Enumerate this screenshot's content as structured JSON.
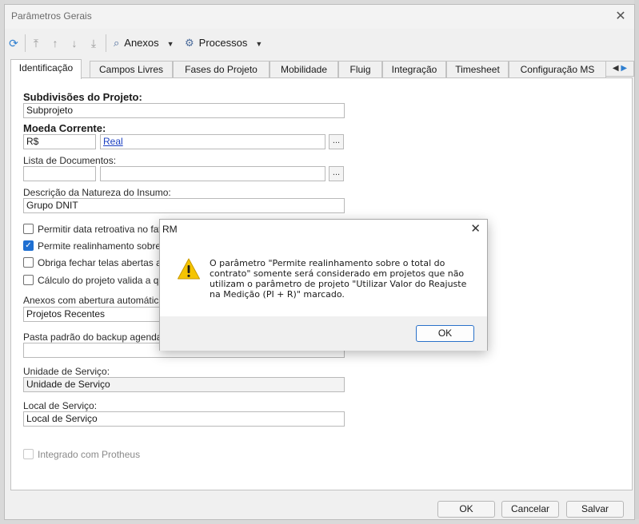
{
  "window": {
    "title": "Parâmetros Gerais"
  },
  "toolbar": {
    "anexos_label": "Anexos",
    "processos_label": "Processos"
  },
  "tabs": [
    "Identificação",
    "Campos Livres",
    "Fases do Projeto",
    "Mobilidade",
    "Fluig",
    "Integração",
    "Timesheet",
    "Configuração MS"
  ],
  "form": {
    "subdivisoes": {
      "label": "Subdivisões do Projeto:",
      "value": "Subprojeto"
    },
    "moeda": {
      "label": "Moeda Corrente:",
      "code": "R$",
      "name": "Real"
    },
    "lista_documentos": {
      "label": "Lista de Documentos:",
      "value1": "",
      "value2": ""
    },
    "natureza": {
      "label": "Descrição da Natureza do Insumo:",
      "value": "Grupo DNIT"
    },
    "checkboxes": [
      {
        "label": "Permitir data retroativa no fatur",
        "checked": false
      },
      {
        "label": "Permite realinhamento sobre o t",
        "checked": true
      },
      {
        "label": "Obriga fechar telas abertas ante",
        "checked": false
      },
      {
        "label": "Cálculo do projeto valida a quan",
        "checked": false
      }
    ],
    "anexos_abertura": {
      "label": "Anexos com abertura automática na",
      "value": "Projetos Recentes"
    },
    "pasta_backup": {
      "label": "Pasta padrão do backup agendado:",
      "value": ""
    },
    "unidade_servico": {
      "label": "Unidade de Serviço:",
      "value": "Unidade de Serviço"
    },
    "local_servico": {
      "label": "Local de Serviço:",
      "value": "Local de Serviço"
    },
    "protheus": {
      "label": "Integrado com Protheus",
      "checked": false
    }
  },
  "buttons": {
    "ok": "OK",
    "cancel": "Cancelar",
    "save": "Salvar"
  },
  "dialog": {
    "title": "RM",
    "message": "O parâmetro \"Permite realinhamento sobre o total do contrato\" somente será considerado em projetos que não utilizam o parâmetro de projeto \"Utilizar Valor do Reajuste na Medição (PI + R)\" marcado.",
    "ok": "OK"
  },
  "colors": {
    "accent": "#1f6fd1",
    "link": "#1a3fc1",
    "warning": "#f5c400"
  }
}
